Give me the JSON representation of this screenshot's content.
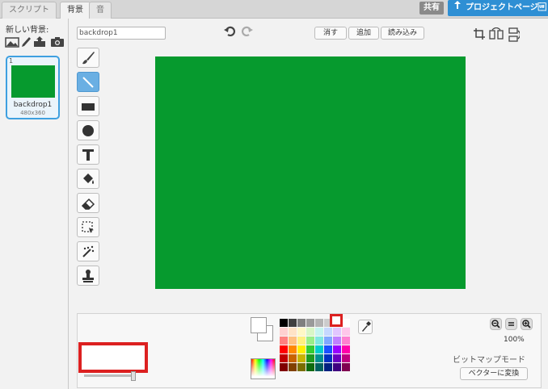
{
  "tabs": [
    {
      "label": "スクリプト"
    },
    {
      "label": "背景"
    },
    {
      "label": "音"
    }
  ],
  "header": {
    "share_label": "共有",
    "project_page_label": "プロジェクトページ\u001f"
  },
  "backdrops": {
    "new_label": "新しい背景:",
    "items": [
      {
        "index": "1",
        "name": "backdrop1",
        "size": "480x360",
        "color": "#069a2e"
      }
    ]
  },
  "editor": {
    "name_value": "backdrop1",
    "clear_label": "消す",
    "add_label": "追加",
    "import_label": "読み込み",
    "canvas_color": "#069a2e",
    "tools": [
      {
        "name": "paintbrush-icon",
        "selected": false
      },
      {
        "name": "line-icon",
        "selected": true
      },
      {
        "name": "rectangle-icon",
        "selected": false
      },
      {
        "name": "ellipse-icon",
        "selected": false
      },
      {
        "name": "text-icon",
        "selected": false
      },
      {
        "name": "fill-icon",
        "selected": false
      },
      {
        "name": "eraser-icon",
        "selected": false
      },
      {
        "name": "select-icon",
        "selected": false
      },
      {
        "name": "remove-background-icon",
        "selected": false
      },
      {
        "name": "stamp-icon",
        "selected": false
      }
    ]
  },
  "color_panel": {
    "zoom_level": "100%",
    "mode_label": "ビットマップモード",
    "convert_label": "ベクターに変換",
    "palette": [
      "#000000",
      "#404040",
      "#7f7f7f",
      "#9a9a9a",
      "#b3b3b3",
      "#cccccc",
      "#e6e6e6",
      "#ffffff",
      "#ffd0d0",
      "#ffe3c6",
      "#fff8c6",
      "#d9f7c6",
      "#c6f5f0",
      "#c6d8ff",
      "#e2c6ff",
      "#ffc6ea",
      "#ff8080",
      "#ffc080",
      "#fff080",
      "#99ee88",
      "#80e8e0",
      "#80a8ff",
      "#c080ff",
      "#ff80d0",
      "#ff0000",
      "#ff8800",
      "#ffee00",
      "#33cc33",
      "#00cccc",
      "#1a50ff",
      "#9900ff",
      "#ff00aa",
      "#c00000",
      "#c86400",
      "#c8b400",
      "#1f9a1f",
      "#009090",
      "#0030c0",
      "#6a00c0",
      "#c00080",
      "#800000",
      "#804000",
      "#7a6e00",
      "#0f6a0f",
      "#006060",
      "#002080",
      "#400080",
      "#800050"
    ]
  }
}
